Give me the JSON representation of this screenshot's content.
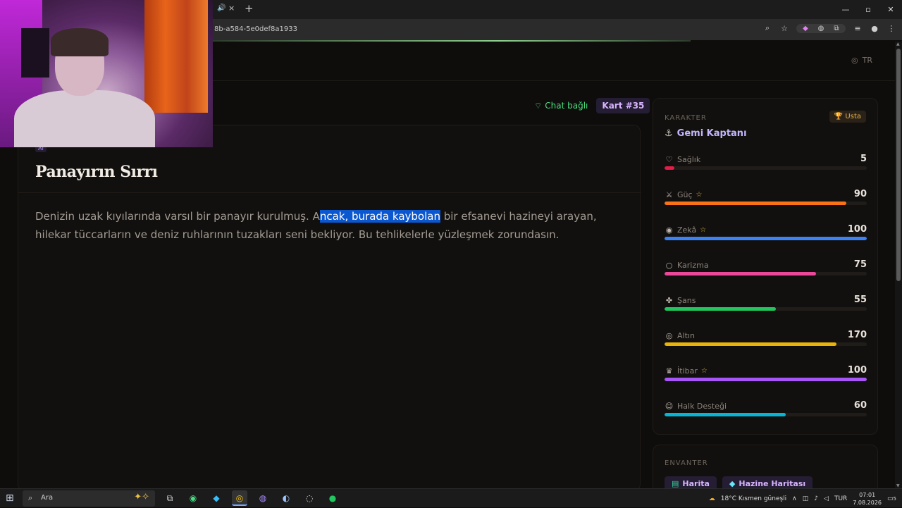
{
  "browser": {
    "url": "8b-a584-5e0def8a1933",
    "tab_close": "×",
    "tab_new": "+",
    "window_controls": [
      "—",
      "▫",
      "✕"
    ]
  },
  "page": {
    "lang": "TR",
    "chat_status": "Chat bağlı",
    "card_badge": "Kart #35",
    "story": {
      "badge": "AI",
      "title": "Panayırın Sırrı",
      "text_before": "Denizin uzak kıyılarında varsıl bir panayır kurulmuş. A",
      "text_highlight": "ncak, burada kaybolan",
      "text_after": " bir efsanevi hazineyi arayan, hilekar tüccarların ve deniz ruhlarının tuzakları seni bekliyor. Bu tehlikelerle yüzleşmek zorundasın."
    },
    "character": {
      "section_label": "KARAKTER",
      "rank": "Usta",
      "name": "Gemi Kaptanı",
      "stats": [
        {
          "label": "Sağlık",
          "value": "5",
          "icon": "heart-icon",
          "glyph": "♡",
          "star": false,
          "pct": 0.05,
          "color": "#e11d48"
        },
        {
          "label": "Güç",
          "value": "90",
          "icon": "sword-icon",
          "glyph": "⚔",
          "star": true,
          "pct": 0.9,
          "color": "#f97316"
        },
        {
          "label": "Zekâ",
          "value": "100",
          "icon": "brain-icon",
          "glyph": "◉",
          "star": true,
          "pct": 1.0,
          "color": "#3b82f6"
        },
        {
          "label": "Karizma",
          "value": "75",
          "icon": "chat-icon",
          "glyph": "○",
          "star": false,
          "pct": 0.75,
          "color": "#ec4899"
        },
        {
          "label": "Şans",
          "value": "55",
          "icon": "clover-icon",
          "glyph": "✤",
          "star": false,
          "pct": 0.55,
          "color": "#22c55e"
        },
        {
          "label": "Altın",
          "value": "170",
          "icon": "coins-icon",
          "glyph": "◎",
          "star": false,
          "pct": 0.85,
          "color": "#eab308"
        },
        {
          "label": "İtibar",
          "value": "100",
          "icon": "crown-icon",
          "glyph": "♛",
          "star": true,
          "pct": 1.0,
          "color": "#a855f7"
        },
        {
          "label": "Halk Desteği",
          "value": "60",
          "icon": "people-icon",
          "glyph": "☺",
          "star": false,
          "pct": 0.6,
          "color": "#06b6d4"
        }
      ]
    },
    "inventory": {
      "section_label": "ENVANTER",
      "items": [
        {
          "label": "Harita",
          "glyph": "▤"
        },
        {
          "label": "Hazine Haritası",
          "glyph": "◆"
        }
      ]
    }
  },
  "taskbar": {
    "search_placeholder": "Ara",
    "weather": "18°C  Kısmen güneşli",
    "lang": "TUR",
    "time": "07:01",
    "date": "7.08.2026",
    "notif_count": "5"
  }
}
